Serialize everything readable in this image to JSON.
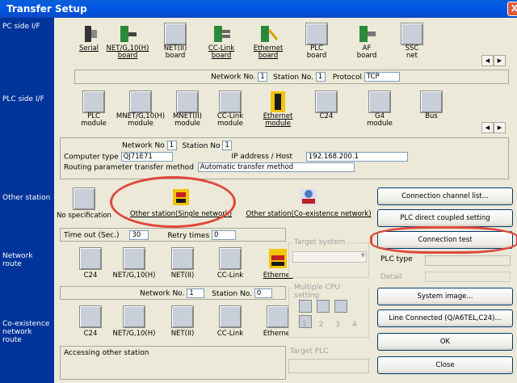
{
  "window": {
    "title": "Transfer Setup",
    "close": "X"
  },
  "sidebar": {
    "pc_side": "PC side I/F",
    "plc_side": "PLC side I/F",
    "other_station": "Other station",
    "network_route": "Network route",
    "coexistence_route": "Co-existence network route"
  },
  "pc_side": {
    "items": [
      {
        "label1": "Serial",
        "label2": ""
      },
      {
        "label1": "NET/G,10(H)",
        "label2": "board"
      },
      {
        "label1": "NET(II)",
        "label2": "board"
      },
      {
        "label1": "CC-Link",
        "label2": "board"
      },
      {
        "label1": "Ethernet",
        "label2": "board"
      },
      {
        "label1": "PLC",
        "label2": "board"
      },
      {
        "label1": "AF",
        "label2": "board"
      },
      {
        "label1": "SSC",
        "label2": "net"
      }
    ],
    "network_no_label": "Network No.",
    "network_no": "1",
    "station_no_label": "Station No.",
    "station_no": "1",
    "protocol_label": "Protocol",
    "protocol": "TCP"
  },
  "plc_side": {
    "items": [
      {
        "label1": "PLC",
        "label2": "module"
      },
      {
        "label1": "MNET/G,10(H)",
        "label2": "module"
      },
      {
        "label1": "MNET(II)",
        "label2": "module"
      },
      {
        "label1": "CC-Link",
        "label2": "module"
      },
      {
        "label1": "Ethernet",
        "label2": "module"
      },
      {
        "label1": "C24",
        "label2": ""
      },
      {
        "label1": "G4",
        "label2": "module"
      },
      {
        "label1": "Bus",
        "label2": ""
      }
    ],
    "network_no_label": "Network No",
    "network_no": "1",
    "station_no_label": "Station No",
    "station_no": "1",
    "computer_type_label": "Computer type",
    "computer_type": "QJ71E71",
    "ip_label": "IP address / Host",
    "ip": "192.168.200.1",
    "routing_label": "Routing parameter transfer method",
    "routing": "Automatic transfer method"
  },
  "other_station": {
    "no_spec": "No specification",
    "single": "Other station(Single network)",
    "coexist": "Other station(Co-existence network)",
    "timeout_label": "Time out (Sec.)",
    "timeout": "30",
    "retry_label": "Retry times",
    "retry": "0"
  },
  "network_route": {
    "items": [
      "C24",
      "NET/G,10(H)",
      "NET(II)",
      "CC-Link",
      "Ethernet"
    ],
    "network_no_label": "Network No.",
    "network_no": "1",
    "station_no_label": "Station No.",
    "station_no": "0"
  },
  "coexist_route": {
    "items": [
      "C24",
      "NET/G,10(H)",
      "NET(II)",
      "CC-Link",
      "Ethernet"
    ],
    "status": "Accessing other station"
  },
  "target": {
    "target_system": "Target system",
    "multiple_cpu": "Multiple CPU setting",
    "cpu_numbers": [
      "1",
      "2",
      "3",
      "4"
    ],
    "target_plc": "Target PLC",
    "plc_type_label": "PLC type",
    "detail_label": "Detail"
  },
  "buttons": {
    "connection_channel": "Connection channel list...",
    "plc_direct": "PLC direct coupled setting",
    "connection_test": "Connection test",
    "system_image": "System image...",
    "line_connected": "Line Connected (Q/A6TEL,C24)...",
    "ok": "OK",
    "close": "Close"
  },
  "colors": {
    "title_bar": "#0058e6",
    "sidebar": "#00349a",
    "highlight": "#e0473b"
  }
}
